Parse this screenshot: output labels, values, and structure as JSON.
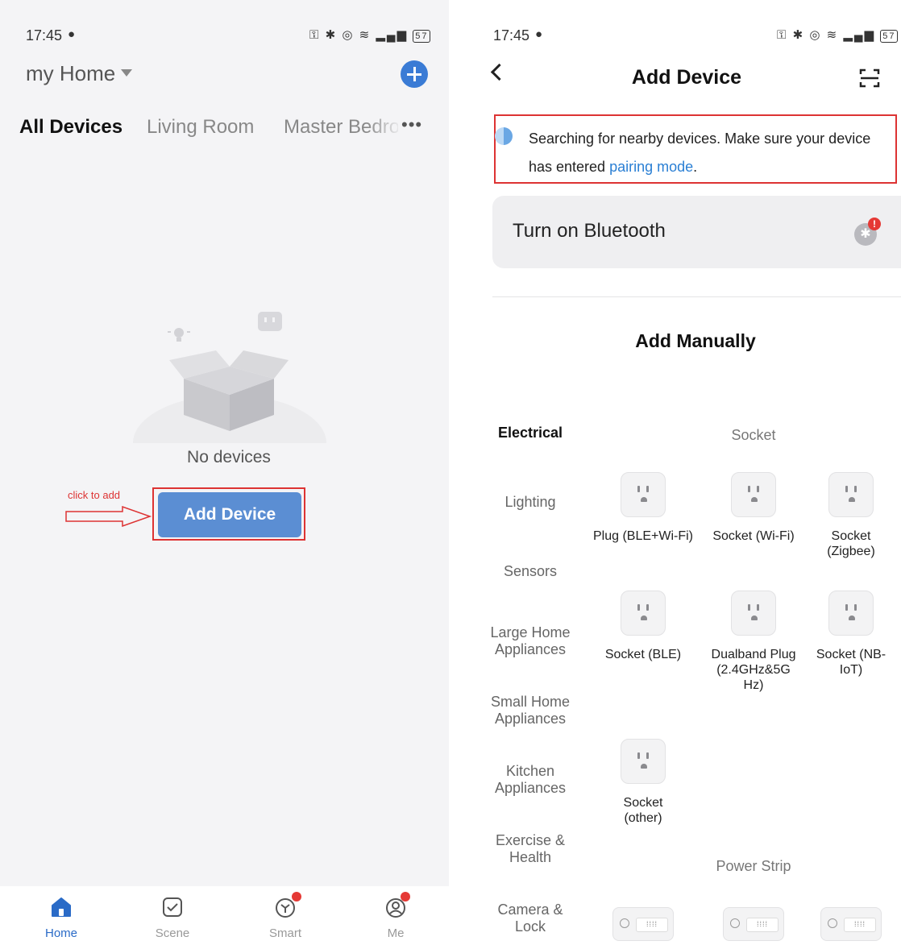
{
  "left": {
    "status_time": "17:45",
    "home_title": "my Home",
    "tabs": [
      "All Devices",
      "Living Room",
      "Master Bedroom"
    ],
    "more": "•••",
    "empty_text": "No devices",
    "annotation": "click to add",
    "add_button": "Add Device",
    "tabbar": [
      {
        "label": "Home",
        "icon": "home-icon",
        "active": true
      },
      {
        "label": "Scene",
        "icon": "scene-checkbox-icon",
        "active": false
      },
      {
        "label": "Smart",
        "icon": "smart-cube-icon",
        "active": false,
        "badge": true
      },
      {
        "label": "Me",
        "icon": "profile-icon",
        "active": false,
        "badge": true
      }
    ]
  },
  "right": {
    "status_time": "17:45",
    "title": "Add Device",
    "search_msg_before": "Searching for nearby devices. Make sure your device has entered ",
    "search_link": "pairing mode",
    "search_msg_after": ".",
    "bluetooth_label": "Turn on Bluetooth",
    "manual_title": "Add Manually",
    "categories": [
      "Electrical",
      "Lighting",
      "Sensors",
      "Large Home Appliances",
      "Small Home Appliances",
      "Kitchen Appliances",
      "Exercise & Health",
      "Camera & Lock"
    ],
    "section_socket": "Socket",
    "devices": [
      {
        "name": "Plug (BLE+Wi-Fi)"
      },
      {
        "name": "Socket (Wi-Fi)"
      },
      {
        "name": "Socket (Zigbee)"
      },
      {
        "name": "Socket (BLE)"
      },
      {
        "name": "Dualband Plug (2.4GHz&5G Hz)"
      },
      {
        "name": "Socket (NB-IoT)"
      },
      {
        "name": "Socket (other)"
      }
    ],
    "section_strip": "Power Strip"
  },
  "status_battery": "57",
  "colors": {
    "accent": "#3a7bd5",
    "highlight": "#d33333",
    "link": "#2a7fd4",
    "badge": "#e53935"
  }
}
